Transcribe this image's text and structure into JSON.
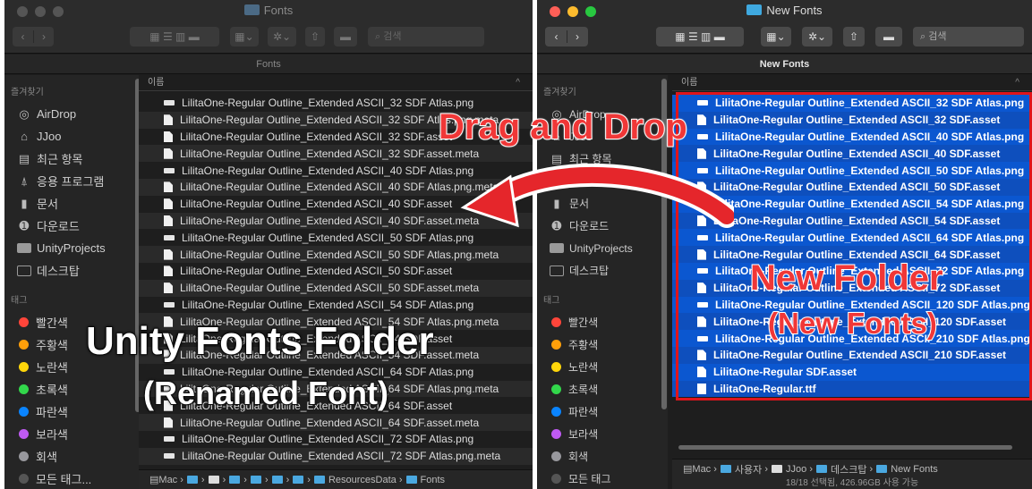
{
  "left_window": {
    "title": "Fonts",
    "path_header": "Fonts",
    "search_placeholder": "검색",
    "sidebar": {
      "favorites_label": "즐겨찾기",
      "items": [
        {
          "label": "AirDrop",
          "icon": "airdrop-icon"
        },
        {
          "label": "JJoo",
          "icon": "home-icon"
        },
        {
          "label": "최근 항목",
          "icon": "clock-icon"
        },
        {
          "label": "응용 프로그램",
          "icon": "applications-icon"
        },
        {
          "label": "문서",
          "icon": "document-icon"
        },
        {
          "label": "다운로드",
          "icon": "download-icon"
        },
        {
          "label": "UnityProjects",
          "icon": "folder-icon"
        },
        {
          "label": "데스크탑",
          "icon": "desktop-icon"
        }
      ],
      "tags_label": "태그",
      "tags": [
        {
          "label": "빨간색",
          "color": "#ff453a"
        },
        {
          "label": "주황색",
          "color": "#ff9f0a"
        },
        {
          "label": "노란색",
          "color": "#ffd60a"
        },
        {
          "label": "초록색",
          "color": "#32d74b"
        },
        {
          "label": "파란색",
          "color": "#0a84ff"
        },
        {
          "label": "보라색",
          "color": "#bf5af2"
        },
        {
          "label": "회색",
          "color": "#98989d"
        },
        {
          "label": "모든 태그...",
          "color": "#555555"
        }
      ]
    },
    "column_header": "이름",
    "files": [
      {
        "name": "LilitaOne-Regular Outline_Extended ASCII_32 SDF Atlas.png",
        "type": "img"
      },
      {
        "name": "LilitaOne-Regular Outline_Extended ASCII_32 SDF Atlas.png.meta",
        "type": "doc"
      },
      {
        "name": "LilitaOne-Regular Outline_Extended ASCII_32 SDF.asset",
        "type": "doc"
      },
      {
        "name": "LilitaOne-Regular Outline_Extended ASCII_32 SDF.asset.meta",
        "type": "doc"
      },
      {
        "name": "LilitaOne-Regular Outline_Extended ASCII_40 SDF Atlas.png",
        "type": "img"
      },
      {
        "name": "LilitaOne-Regular Outline_Extended ASCII_40 SDF Atlas.png.meta",
        "type": "doc"
      },
      {
        "name": "LilitaOne-Regular Outline_Extended ASCII_40 SDF.asset",
        "type": "doc"
      },
      {
        "name": "LilitaOne-Regular Outline_Extended ASCII_40 SDF.asset.meta",
        "type": "doc"
      },
      {
        "name": "LilitaOne-Regular Outline_Extended ASCII_50 SDF Atlas.png",
        "type": "img"
      },
      {
        "name": "LilitaOne-Regular Outline_Extended ASCII_50 SDF Atlas.png.meta",
        "type": "doc"
      },
      {
        "name": "LilitaOne-Regular Outline_Extended ASCII_50 SDF.asset",
        "type": "doc"
      },
      {
        "name": "LilitaOne-Regular Outline_Extended ASCII_50 SDF.asset.meta",
        "type": "doc"
      },
      {
        "name": "LilitaOne-Regular Outline_Extended ASCII_54 SDF Atlas.png",
        "type": "img"
      },
      {
        "name": "LilitaOne-Regular Outline_Extended ASCII_54 SDF Atlas.png.meta",
        "type": "doc"
      },
      {
        "name": "LilitaOne-Regular Outline_Extended ASCII_54 SDF.asset",
        "type": "doc"
      },
      {
        "name": "LilitaOne-Regular Outline_Extended ASCII_54 SDF.asset.meta",
        "type": "doc"
      },
      {
        "name": "LilitaOne-Regular Outline_Extended ASCII_64 SDF Atlas.png",
        "type": "img"
      },
      {
        "name": "LilitaOne-Regular Outline_Extended ASCII_64 SDF Atlas.png.meta",
        "type": "doc"
      },
      {
        "name": "LilitaOne-Regular Outline_Extended ASCII_64 SDF.asset",
        "type": "doc"
      },
      {
        "name": "LilitaOne-Regular Outline_Extended ASCII_64 SDF.asset.meta",
        "type": "doc"
      },
      {
        "name": "LilitaOne-Regular Outline_Extended ASCII_72 SDF Atlas.png",
        "type": "img"
      },
      {
        "name": "LilitaOne-Regular Outline_Extended ASCII_72 SDF Atlas.png.meta",
        "type": "img"
      }
    ],
    "breadcrumb": {
      "root": "Mac",
      "last_visible": "ResourcesData",
      "current": "Fonts"
    }
  },
  "right_window": {
    "title": "New Fonts",
    "path_header": "New Fonts",
    "search_placeholder": "검색",
    "sidebar": {
      "favorites_label": "즐겨찾기",
      "items": [
        {
          "label": "AirDrop",
          "icon": "airdrop-icon"
        },
        {
          "label": "JJoo",
          "icon": "home-icon"
        },
        {
          "label": "최근 항목",
          "icon": "clock-icon"
        },
        {
          "label": "응용 프로그램",
          "icon": "applications-icon"
        },
        {
          "label": "문서",
          "icon": "document-icon"
        },
        {
          "label": "다운로드",
          "icon": "download-icon"
        },
        {
          "label": "UnityProjects",
          "icon": "folder-icon"
        },
        {
          "label": "데스크탑",
          "icon": "desktop-icon"
        }
      ],
      "tags_label": "태그",
      "tags": [
        {
          "label": "빨간색",
          "color": "#ff453a"
        },
        {
          "label": "주황색",
          "color": "#ff9f0a"
        },
        {
          "label": "노란색",
          "color": "#ffd60a"
        },
        {
          "label": "초록색",
          "color": "#32d74b"
        },
        {
          "label": "파란색",
          "color": "#0a84ff"
        },
        {
          "label": "보라색",
          "color": "#bf5af2"
        },
        {
          "label": "회색",
          "color": "#98989d"
        },
        {
          "label": "모든 태그",
          "color": "#555555"
        }
      ]
    },
    "column_header": "이름",
    "files": [
      {
        "name": "LilitaOne-Regular Outline_Extended ASCII_32 SDF Atlas.png",
        "type": "img"
      },
      {
        "name": "LilitaOne-Regular Outline_Extended ASCII_32 SDF.asset",
        "type": "doc"
      },
      {
        "name": "LilitaOne-Regular Outline_Extended ASCII_40 SDF Atlas.png",
        "type": "img"
      },
      {
        "name": "LilitaOne-Regular Outline_Extended ASCII_40 SDF.asset",
        "type": "doc"
      },
      {
        "name": "LilitaOne-Regular Outline_Extended ASCII_50 SDF Atlas.png",
        "type": "img"
      },
      {
        "name": "LilitaOne-Regular Outline_Extended ASCII_50 SDF.asset",
        "type": "doc"
      },
      {
        "name": "LilitaOne-Regular Outline_Extended ASCII_54 SDF Atlas.png",
        "type": "img"
      },
      {
        "name": "LilitaOne-Regular Outline_Extended ASCII_54 SDF.asset",
        "type": "doc"
      },
      {
        "name": "LilitaOne-Regular Outline_Extended ASCII_64 SDF Atlas.png",
        "type": "img"
      },
      {
        "name": "LilitaOne-Regular Outline_Extended ASCII_64 SDF.asset",
        "type": "doc"
      },
      {
        "name": "LilitaOne-Regular Outline_Extended ASCII_72 SDF Atlas.png",
        "type": "img"
      },
      {
        "name": "LilitaOne-Regular Outline_Extended ASCII_72 SDF.asset",
        "type": "doc"
      },
      {
        "name": "LilitaOne-Regular Outline_Extended ASCII_120 SDF Atlas.png",
        "type": "img"
      },
      {
        "name": "LilitaOne-Regular Outline_Extended ASCII_120 SDF.asset",
        "type": "doc"
      },
      {
        "name": "LilitaOne-Regular Outline_Extended ASCII_210 SDF Atlas.png",
        "type": "img"
      },
      {
        "name": "LilitaOne-Regular Outline_Extended ASCII_210 SDF.asset",
        "type": "doc"
      },
      {
        "name": "LilitaOne-Regular SDF.asset",
        "type": "doc"
      },
      {
        "name": "LilitaOne-Regular.ttf",
        "type": "ttf"
      }
    ],
    "breadcrumb": {
      "root": "Mac",
      "users": "사용자",
      "home": "JJoo",
      "desktop": "데스크탑",
      "current": "New Fonts"
    },
    "status": "18/18 선택됨, 426.96GB 사용 가능"
  },
  "annotations": {
    "drag_drop": "Drag and Drop",
    "new_folder": "New Folder",
    "new_fonts": "(New Fonts)",
    "unity_folder": "Unity Fonts Folder",
    "renamed_font": "(Renamed Font)"
  },
  "colors": {
    "selection": "#0b57d0",
    "annotation_red": "#f03737",
    "highlight_box": "#e0151b",
    "folder_blue": "#3fa9e0"
  }
}
